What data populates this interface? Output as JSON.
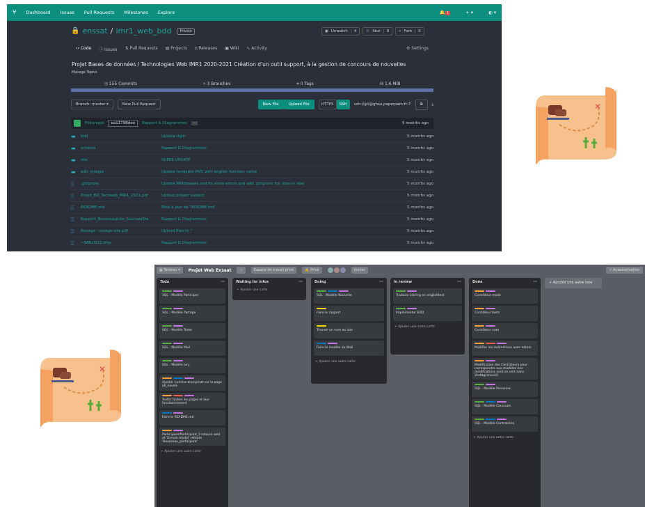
{
  "github": {
    "nav": {
      "logo": "⑂",
      "items": [
        "Dashboard",
        "Issues",
        "Pull Requests",
        "Milestones",
        "Explore"
      ],
      "notif_count": "1",
      "plus": "+ ▾",
      "user": "◐ ▾"
    },
    "repo": {
      "owner": "enssat",
      "sep": "/",
      "name": "imr1_web_bdd",
      "private": "Private"
    },
    "buttons": {
      "unwatch": "Unwatch",
      "unwatch_count": "4",
      "star": "Star",
      "star_count": "0",
      "fork": "Fork",
      "fork_count": "0"
    },
    "tabs": [
      "Code",
      "Issues",
      "Pull Requests",
      "Projects",
      "Releases",
      "Wiki",
      "Activity"
    ],
    "settings": "Settings",
    "description": "Projet Bases de données / Technologies Web IMR1 2020-2021 Création d'un outil support, à la gestion de concours de nouvelles",
    "manage_topics": "Manage Topics",
    "stats": [
      "155 Commits",
      "3 Branches",
      "0 Tags",
      "1.6 MiB"
    ],
    "branch": "Branch: master ▾",
    "new_pr": "New Pull Request",
    "new_file": "New File",
    "upload_file": "Upload File",
    "https": "HTTPS",
    "ssh": "SSH",
    "clone_url": "ssh://git@ghsa.paperpain.fr:713",
    "commit": {
      "author": "Flotenopo",
      "sha": "ea1179Bdee",
      "message": "Rapport & Diagrammes",
      "ellipsis": "···",
      "time": "5 months ago"
    },
    "files": [
      {
        "name": "bdd",
        "msg": "Update right",
        "time": "5 months ago"
      },
      {
        "name": "schema",
        "msg": "Rapport & Diagrammes",
        "time": "5 months ago"
      },
      {
        "name": "site",
        "msg": "SUPER UPDATE",
        "time": "5 months ago"
      },
      {
        "name": "wiki_images",
        "msg": "Update template MVC with english function name",
        "time": "5 months ago"
      },
      {
        "name": ".gitignore",
        "msg": "Update Middleware and fix some errors and add .gitignore for .idea in site/",
        "time": "5 months ago"
      },
      {
        "name": "Projet_BD_Techweb_IMR1_2021.pdf",
        "msg": "Upload project subject",
        "time": "5 months ago"
      },
      {
        "name": "README.md",
        "msg": "Mise à jour de 'README.md'",
        "time": "5 months ago"
      },
      {
        "name": "Rapport_BousseauJulie_GourvesSte...",
        "msg": "Rapport & Diagrammes",
        "time": "5 months ago"
      },
      {
        "name": "Rouage - rouage-site.pdf",
        "msg": "Upload files to ''",
        "time": "5 months ago"
      },
      {
        "name": "~WRL0212.tmp",
        "msg": "Rapport & Diagrammes",
        "time": "5 months ago"
      }
    ]
  },
  "trello": {
    "top": {
      "board_menu": "▦ Tableau ▾",
      "title": "Projet Web Enssat",
      "star": "☆",
      "workspace": "Espace de travail privé",
      "private": "🔒 Privé",
      "invite": "Inviter",
      "automation": "⚡ Automatisation"
    },
    "lists": [
      {
        "name": "Todo",
        "cards": [
          "SQL : Modèle Participer",
          "SQL : Modèle Partage",
          "SQL : Modèle Texte",
          "SQL : Modèle Mail",
          "SQL : Modèle Jury",
          "Ajouter numéro anonymat sur la page all_novels",
          "Tester toutes les pages et leur fonctionnement",
          "Faire le README.md",
          "Participant/Participant_2 retoure wed et 'Ennuie modal' retoure 'Bousseau_participant'"
        ],
        "add": "+ Ajouter une autre carte"
      },
      {
        "name": "Waiting for infos",
        "cards": [],
        "add": "+ Ajouter une carte"
      },
      {
        "name": "Doing",
        "cards": [
          "SQL : Modèle Nouvelle",
          "Faire le rapport",
          "Trouver un nom au site",
          "Faire le modèle du Wall"
        ],
        "add": "+ Ajouter une autre carte"
      },
      {
        "name": "In review",
        "cards": [
          "Traduire cdsring en englishtest",
          "Implémenter BDD"
        ],
        "add": "+ Ajouter une autre carte"
      },
      {
        "name": "Done",
        "cards": [
          "Contrôleur mode",
          "Contrôleur texts",
          "Contrôleur note",
          "Modifier les redirections avec admin",
          "Modification des Contrôleurs pour correspondre aux modèles (les modifications sont en vert dans Vestagranovel)",
          "SQL : Modèle Personne",
          "SQL : Modèle Concours",
          "SQL : Modèle Contraintes"
        ],
        "add": "+ Ajouter une autre carte"
      }
    ],
    "add_list": "+ Ajoutez une autre liste"
  },
  "colors": {
    "teal": "#0d8f80",
    "board_bg": "#5a5e64",
    "map_paper": "#f7c18e",
    "map_fold": "#f4a261"
  }
}
